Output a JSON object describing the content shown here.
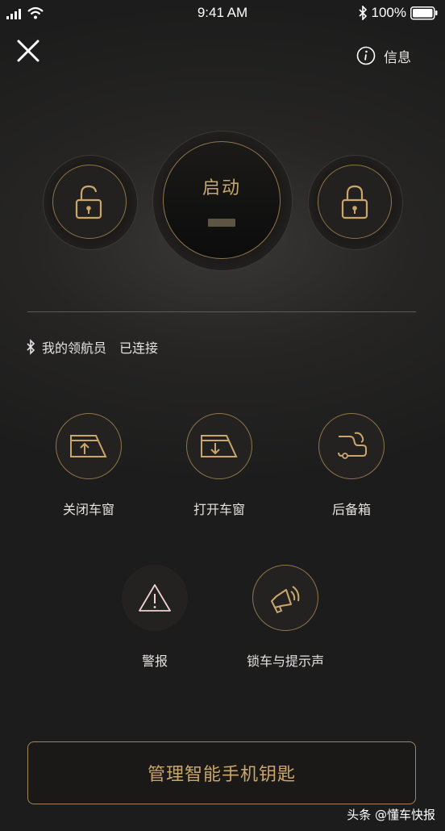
{
  "status_bar": {
    "time": "9:41 AM",
    "battery": "100%"
  },
  "header": {
    "info_label": "信息"
  },
  "controls": {
    "start_label": "启动"
  },
  "connection": {
    "device": "我的领航员",
    "state": "已连接"
  },
  "functions": [
    {
      "label": "关闭车窗"
    },
    {
      "label": "打开车窗"
    },
    {
      "label": "后备箱"
    },
    {
      "label": "警报"
    },
    {
      "label": "锁车与提示声"
    }
  ],
  "manage_button": "管理智能手机钥匙",
  "watermark": "头条 @懂车快报",
  "colors": {
    "accent_gold": "#caa66a",
    "alarm_red": "#b82a2c",
    "background": "#1c1c1c"
  }
}
